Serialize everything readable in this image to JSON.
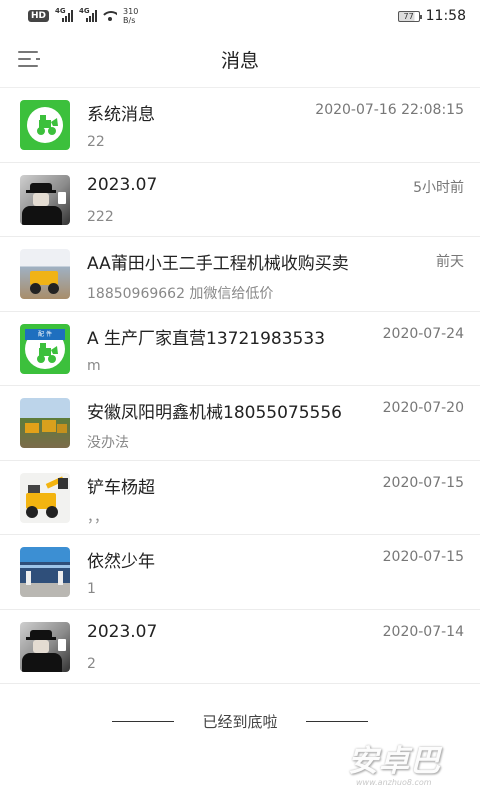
{
  "status_bar": {
    "hd": "HD",
    "signal1_tag": "4G",
    "signal2_tag": "4G",
    "speed": "310",
    "speed_unit": "B/s",
    "battery": "77",
    "time": "11:58"
  },
  "header": {
    "title": "消息"
  },
  "messages": [
    {
      "name": "系统消息",
      "preview": "22",
      "time": "2020-07-16 22:08:15",
      "avatar": "loader-logo-green"
    },
    {
      "name": "2023.07",
      "preview": "222",
      "time": "5小时前",
      "avatar": "man-in-hat-photo"
    },
    {
      "name": "AA莆田小王二手工程机械收购买卖",
      "preview": "18850969662 加微信给低价",
      "time": "前天",
      "avatar": "yellow-loader-photo"
    },
    {
      "name": "A 生产厂家直营13721983533",
      "preview": "m",
      "time": "2020-07-24",
      "avatar": "loader-logo-blue-band",
      "badge": "配 件"
    },
    {
      "name": "安徽凤阳明鑫机械18055075556",
      "preview": "没办法",
      "time": "2020-07-20",
      "avatar": "machinery-yard-photo"
    },
    {
      "name": "铲车杨超",
      "preview": "，，",
      "time": "2020-07-15",
      "avatar": "yellow-wheel-loader-photo"
    },
    {
      "name": "依然少年",
      "preview": "1",
      "time": "2020-07-15",
      "avatar": "building-photo"
    },
    {
      "name": "2023.07",
      "preview": "2",
      "time": "2020-07-14",
      "avatar": "man-in-hat-photo"
    }
  ],
  "footer": {
    "end_text": "已经到底啦"
  },
  "watermark": {
    "text": "安卓巴",
    "url": "www.anzhuo8.com"
  }
}
